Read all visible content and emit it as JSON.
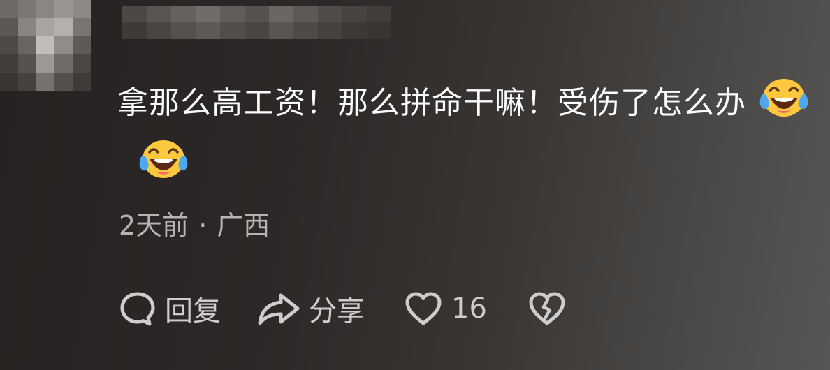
{
  "comment": {
    "text": "拿那么高工资！那么拼命干嘛！受伤了怎么办",
    "emojis": [
      "laughing-crying-emoji",
      "laughing-crying-emoji"
    ],
    "timestamp": "2天前",
    "separator": "·",
    "location": "广西"
  },
  "actions": {
    "reply_label": "回复",
    "reply_icon": "speech-bubble-icon",
    "share_label": "分享",
    "share_icon": "share-arrow-icon",
    "like_count": "16",
    "like_icon": "heart-icon",
    "dislike_icon": "broken-heart-icon"
  },
  "colors": {
    "text": "#ffffff",
    "meta_text": "#b7b5b3",
    "action_text": "#cfcdcb",
    "emoji_face": "#ffc83d"
  }
}
